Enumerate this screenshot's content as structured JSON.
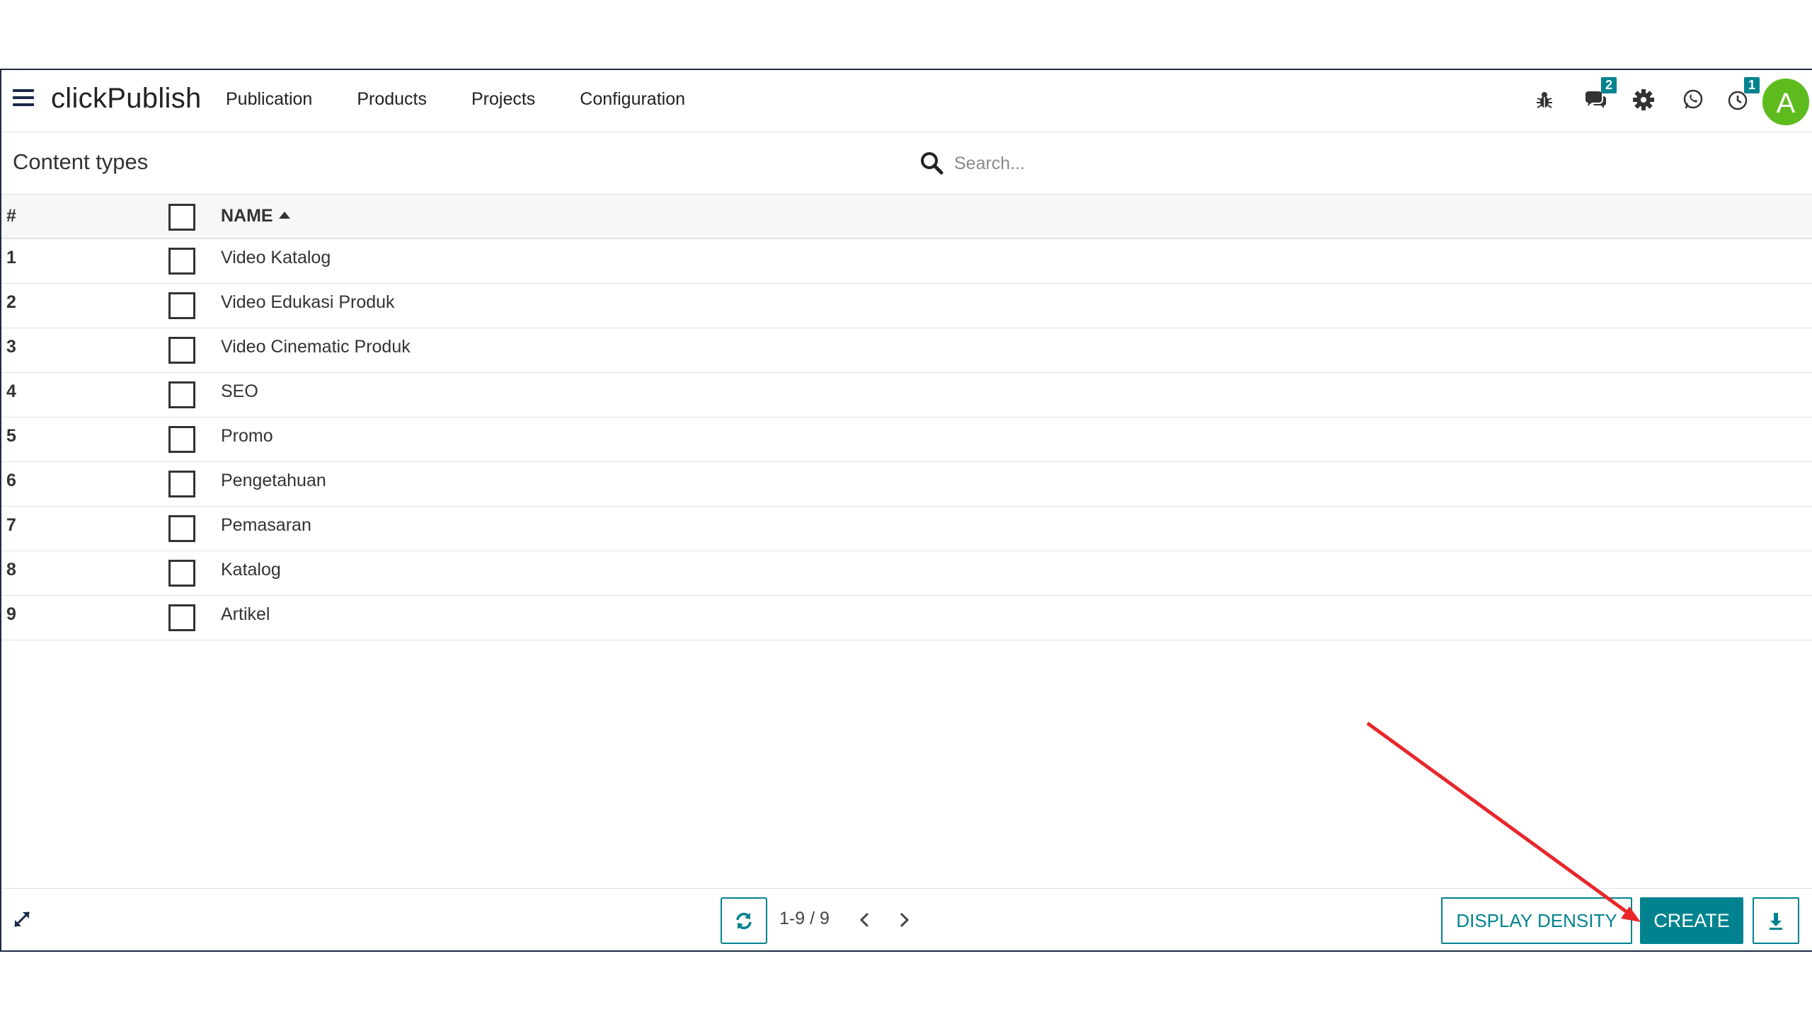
{
  "navbar": {
    "brand": "clickPublish",
    "menu": [
      "Publication",
      "Products",
      "Projects",
      "Configuration"
    ],
    "systray": {
      "messages_badge": "2",
      "activity_badge": "1",
      "avatar_initial": "A"
    }
  },
  "control_panel": {
    "title": "Content types",
    "search_placeholder": "Search..."
  },
  "table": {
    "headers": {
      "num": "#",
      "name": "NAME"
    },
    "rows": [
      {
        "num": "1",
        "name": "Video Katalog"
      },
      {
        "num": "2",
        "name": "Video Edukasi Produk"
      },
      {
        "num": "3",
        "name": "Video Cinematic Produk"
      },
      {
        "num": "4",
        "name": "SEO"
      },
      {
        "num": "5",
        "name": "Promo"
      },
      {
        "num": "6",
        "name": "Pengetahuan"
      },
      {
        "num": "7",
        "name": "Pemasaran"
      },
      {
        "num": "8",
        "name": "Katalog"
      },
      {
        "num": "9",
        "name": "Artikel"
      }
    ]
  },
  "footer": {
    "pager_value": "1-9 / 9",
    "display_density_label": "DISPLAY DENSITY",
    "create_label": "CREATE"
  },
  "colors": {
    "accent": "#00838f",
    "avatar": "#5dbb1e",
    "annotation_arrow": "#e8262a"
  }
}
